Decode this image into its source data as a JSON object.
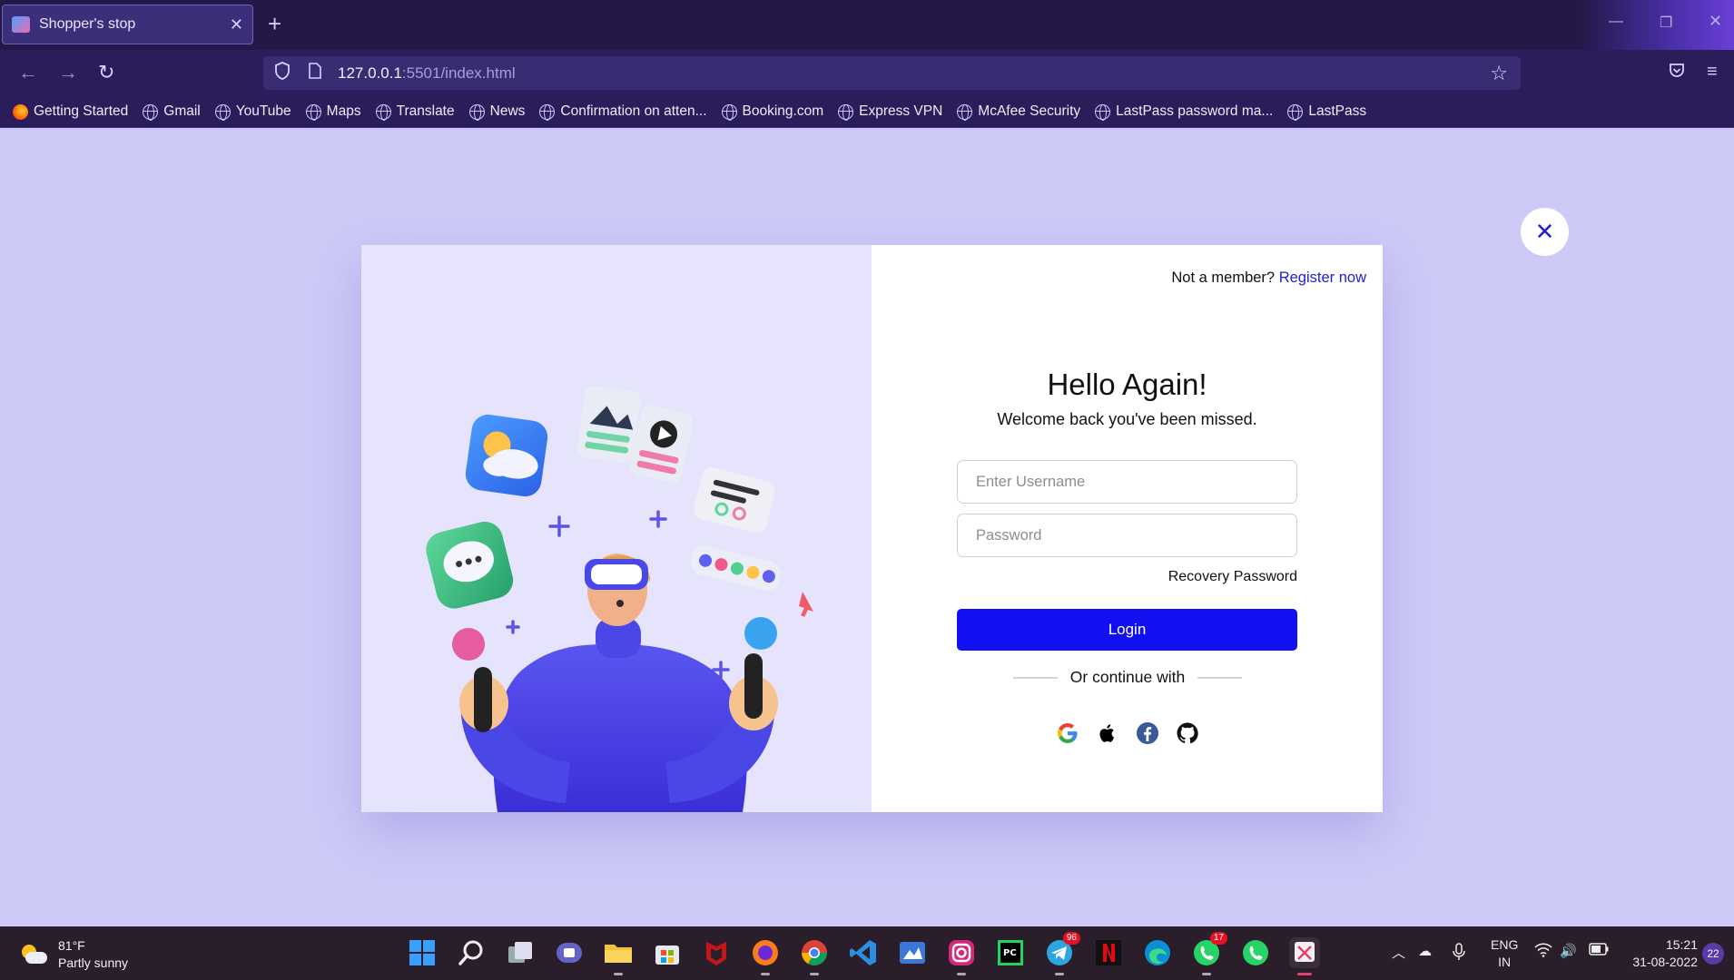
{
  "browser": {
    "tab_title": "Shopper's stop",
    "new_tab": "+",
    "url_host": "127.0.0.1",
    "url_rest": ":5501/index.html",
    "bookmarks": [
      "Getting Started",
      "Gmail",
      "YouTube",
      "Maps",
      "Translate",
      "News",
      "Confirmation on atten...",
      "Booking.com",
      "Express VPN",
      "McAfee Security",
      "LastPass password ma...",
      "LastPass"
    ]
  },
  "modal": {
    "not_member": "Not a member?",
    "register": "Register now",
    "title": "Hello Again!",
    "subtitle": "Welcome back you've been missed.",
    "username_placeholder": "Enter Username",
    "password_placeholder": "Password",
    "recovery": "Recovery Password",
    "login": "Login",
    "or_continue": "Or continue with",
    "social": [
      "google-icon",
      "apple-icon",
      "facebook-icon",
      "github-icon"
    ],
    "close": "✕",
    "login_color": "#1010f0",
    "link_color": "#2222cc"
  },
  "taskbar": {
    "temp": "81°F",
    "weather": "Partly sunny",
    "lang1": "ENG",
    "lang2": "IN",
    "time": "15:21",
    "date": "31-08-2022",
    "notifications": "22",
    "badge_telegram": "96",
    "badge_whatsapp": "17"
  }
}
